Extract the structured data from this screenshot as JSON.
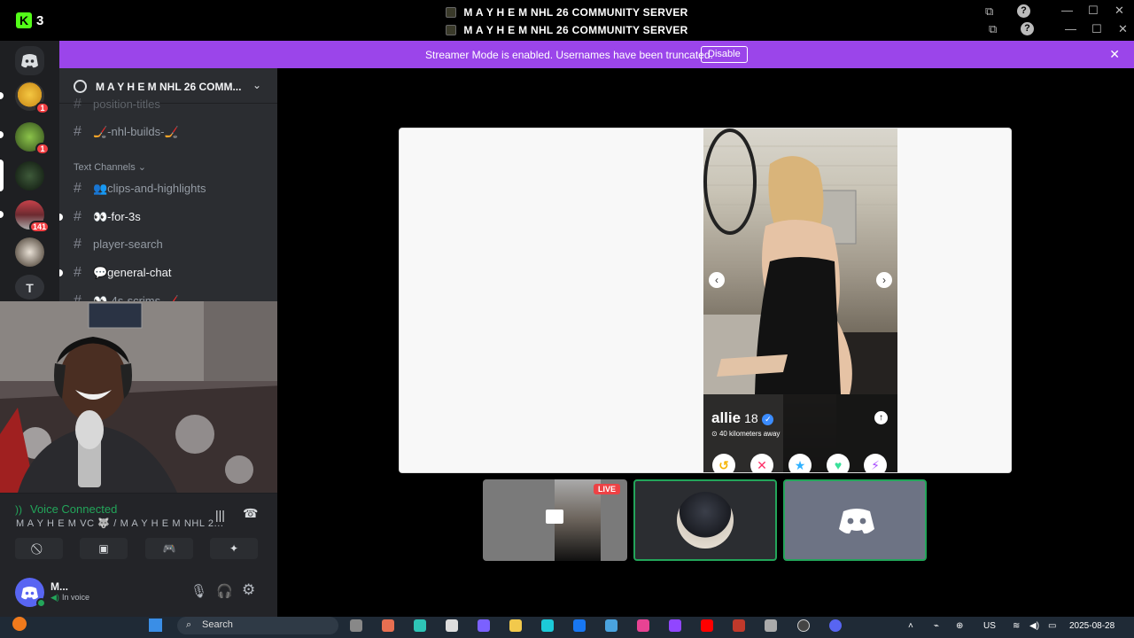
{
  "titlebar": {
    "kick_count": "3",
    "title_primary": "M A Y H E M NHL 26 COMMUNITY SERVER",
    "title_secondary": "M A Y H E M NHL 26 COMMUNITY SERVER"
  },
  "banner": {
    "message": "Streamer Mode is enabled. Usernames have been truncated.",
    "disable_label": "Disable"
  },
  "rail": {
    "servers": [
      {
        "badge": "1"
      },
      {
        "badge": "1"
      },
      {
        "badge": ""
      },
      {
        "badge": "141"
      },
      {
        "badge": ""
      },
      {
        "letter": "T"
      }
    ]
  },
  "sidebar": {
    "server_name": "M A Y H E M NHL 26 COMM...",
    "channels_top": [
      {
        "name": "position-titles"
      },
      {
        "name": "🏒-nhl-builds-🏒"
      }
    ],
    "category": "Text Channels",
    "channels": [
      {
        "name": "👥clips-and-highlights"
      },
      {
        "name": "👀-for-3s"
      },
      {
        "name": "player-search"
      },
      {
        "name": "💬general-chat"
      },
      {
        "name": "👀-4s-scrims-🏒"
      }
    ]
  },
  "voice": {
    "status": "Voice Connected",
    "channel": "M A Y H E M VC 🐺 / M A Y H E M NHL 2..."
  },
  "user": {
    "name": "M...",
    "status": "In voice"
  },
  "profile": {
    "name": "allie",
    "age": "18",
    "distance": "40 kilometers away"
  },
  "tiles": [
    {
      "live_label": "LIVE"
    }
  ],
  "taskbar": {
    "search_placeholder": "Search",
    "language": "US",
    "date": "2025-08-28"
  },
  "colors": {
    "banner": "#9b45ea",
    "voice_green": "#23a55a",
    "blurple": "#5865f2",
    "alert_red": "#ed4245"
  }
}
